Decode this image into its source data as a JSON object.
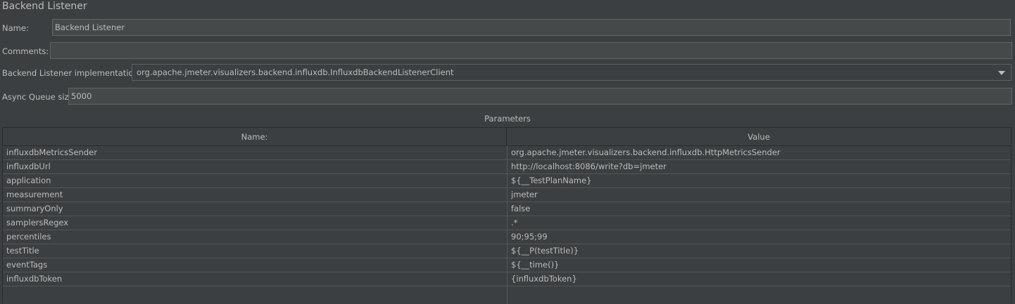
{
  "panel": {
    "title": "Backend Listener"
  },
  "form": {
    "name_label": "Name:",
    "name_value": "Backend Listener",
    "comments_label": "Comments:",
    "comments_value": "",
    "impl_label": "Backend Listener implementation",
    "impl_value": "org.apache.jmeter.visualizers.backend.influxdb.InfluxdbBackendListenerClient",
    "queue_label": "Async Queue size",
    "queue_value": "5000"
  },
  "parameters": {
    "title": "Parameters",
    "columns": [
      "Name:",
      "Value"
    ],
    "rows": [
      {
        "name": "influxdbMetricsSender",
        "value": "org.apache.jmeter.visualizers.backend.influxdb.HttpMetricsSender"
      },
      {
        "name": "influxdbUrl",
        "value": "http://localhost:8086/write?db=jmeter"
      },
      {
        "name": "application",
        "value": "${__TestPlanName}"
      },
      {
        "name": "measurement",
        "value": "jmeter"
      },
      {
        "name": "summaryOnly",
        "value": "false"
      },
      {
        "name": "samplersRegex",
        "value": ".*"
      },
      {
        "name": "percentiles",
        "value": "90;95;99"
      },
      {
        "name": "testTitle",
        "value": "${__P(testTitle)}"
      },
      {
        "name": "eventTags",
        "value": "${__time()}"
      },
      {
        "name": "influxdbToken",
        "value": "{influxdbToken}"
      }
    ]
  },
  "icons": {
    "combo_arrow": "chevron-down-icon"
  },
  "colors": {
    "background": "#3c3f41",
    "field_background": "#45494a",
    "text": "#bbbbbb",
    "border": "#646464"
  }
}
